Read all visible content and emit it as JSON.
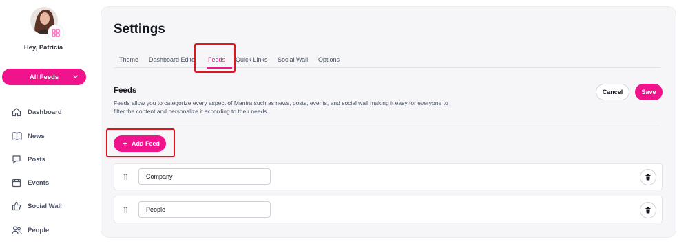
{
  "user": {
    "greeting": "Hey, Patricia"
  },
  "feed_selector": {
    "label": "All Feeds"
  },
  "sidebar": {
    "items": [
      {
        "label": "Dashboard",
        "icon": "home-icon"
      },
      {
        "label": "News",
        "icon": "book-icon"
      },
      {
        "label": "Posts",
        "icon": "chat-icon"
      },
      {
        "label": "Events",
        "icon": "calendar-icon"
      },
      {
        "label": "Social Wall",
        "icon": "thumbs-up-icon"
      },
      {
        "label": "People",
        "icon": "people-icon"
      }
    ]
  },
  "page": {
    "title": "Settings"
  },
  "tabs": [
    {
      "label": "Theme"
    },
    {
      "label": "Dashboard Edito"
    },
    {
      "label": "Feeds",
      "active": true
    },
    {
      "label": "Quick Links"
    },
    {
      "label": "Social Wall"
    },
    {
      "label": "Options"
    }
  ],
  "feeds_section": {
    "title": "Feeds",
    "description": "Feeds allow you to categorize every aspect of Mantra such as news, posts, events, and social wall making it easy for everyone to filter the content and personalize it according to their needs.",
    "cancel_label": "Cancel",
    "save_label": "Save",
    "add_label": "Add Feed",
    "items": [
      {
        "value": "Company"
      },
      {
        "value": "People"
      }
    ]
  },
  "colors": {
    "accent": "#f0138c",
    "annotation": "#e0151f"
  }
}
